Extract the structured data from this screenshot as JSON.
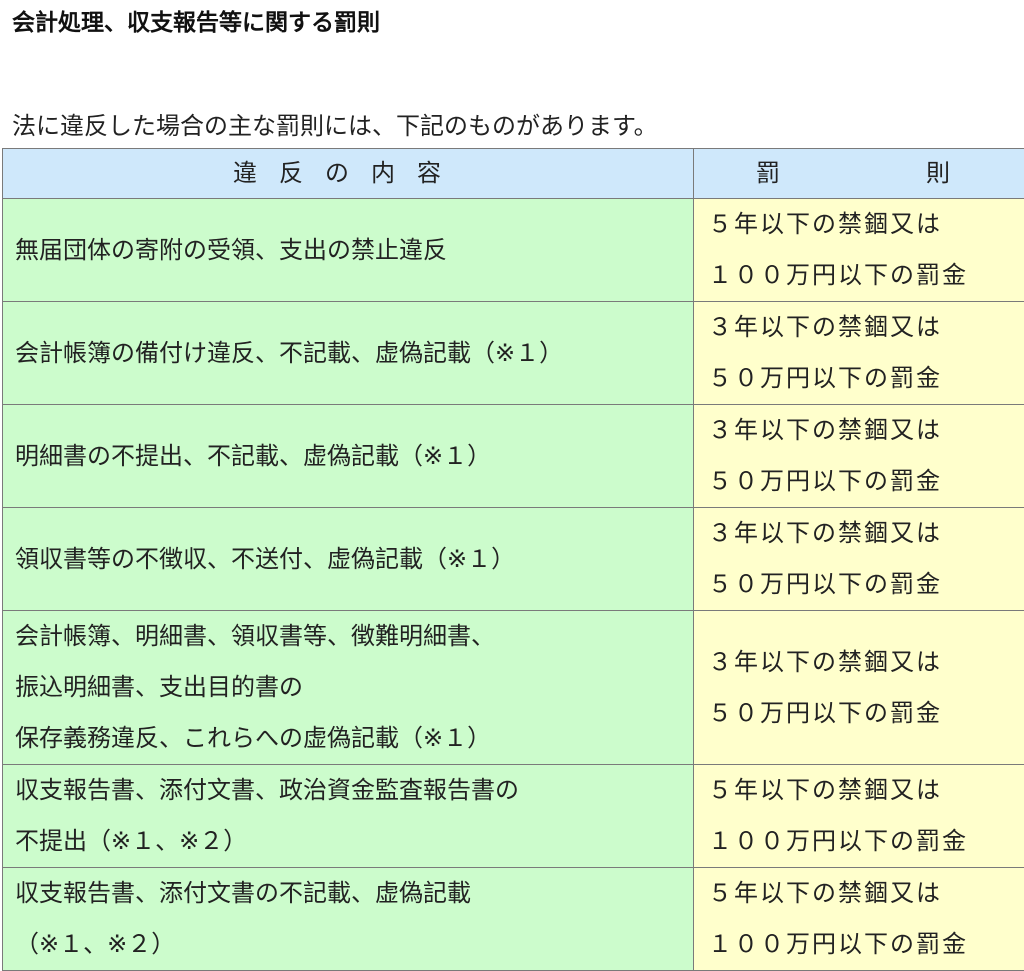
{
  "page": {
    "title": "会計処理、収支報告等に関する罰則",
    "intro": "法に違反した場合の主な罰則には、下記のものがあります。"
  },
  "table": {
    "headers": {
      "violation": "違反の内容",
      "penalty_a": "罰",
      "penalty_b": "則"
    },
    "rows": [
      {
        "violation": "無届団体の寄附の受領、支出の禁止違反",
        "penalty": "５年以下の禁錮又は\n１００万円以下の罰金"
      },
      {
        "violation": "会計帳簿の備付け違反、不記載、虚偽記載（※１）",
        "penalty": "３年以下の禁錮又は\n５０万円以下の罰金"
      },
      {
        "violation": "明細書の不提出、不記載、虚偽記載（※１）",
        "penalty": "３年以下の禁錮又は\n５０万円以下の罰金"
      },
      {
        "violation": "領収書等の不徴収、不送付、虚偽記載（※１）",
        "penalty": "３年以下の禁錮又は\n５０万円以下の罰金"
      },
      {
        "violation": "会計帳簿、明細書、領収書等、徴難明細書、\n振込明細書、支出目的書の\n保存義務違反、これらへの虚偽記載（※１）",
        "penalty": "３年以下の禁錮又は\n５０万円以下の罰金"
      },
      {
        "violation": "収支報告書、添付文書、政治資金監査報告書の\n不提出（※１、※２）",
        "penalty": "５年以下の禁錮又は\n１００万円以下の罰金"
      },
      {
        "violation": "収支報告書、添付文書の不記載、虚偽記載\n（※１、※２）",
        "penalty": "５年以下の禁錮又は\n１００万円以下の罰金"
      }
    ]
  },
  "colors": {
    "header_bg": "#cfe8fb",
    "violation_bg": "#ccfccc",
    "penalty_bg": "#ffffcc",
    "border": "#7a7a7a"
  }
}
